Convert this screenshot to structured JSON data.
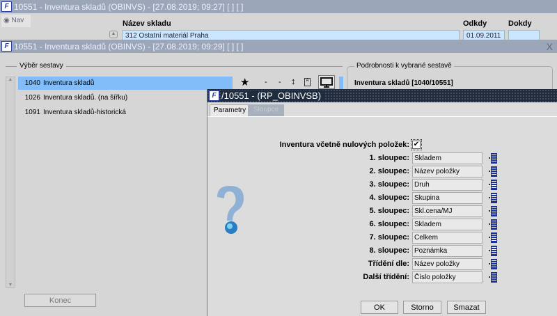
{
  "back_window": {
    "title": "10551 - Inventura skladů (OBINVS) - [27.08.2019; 09:27]  [ ]  [ ]",
    "nav_label": "Nav",
    "col_nazev": "Název skladu",
    "col_odkdy": "Odkdy",
    "col_dokdy": "Dokdy",
    "nazev_value": "312 Ostatní materiál Praha",
    "odkdy_value": "01.09.2011",
    "dokdy_value": ""
  },
  "front_window": {
    "title": "10551 - Inventura skladů (OBINVS) - [27.08.2019; 09:29]  [ ]  [ ]",
    "close": "X",
    "vyber_label": "Výběr sestavy",
    "detail_label": "Podrobnosti k vybrané sestavě",
    "detail_value": "Inventura skladů [1040/10551]",
    "reports": [
      {
        "num": "1040",
        "name": "Inventura skladů",
        "selected": true
      },
      {
        "num": "1026",
        "name": "Inventura skladů. (na šířku)"
      },
      {
        "num": "1091",
        "name": "Inventura skladů-historická"
      }
    ],
    "konec": "Konec",
    "toolbar": {
      "dash1": "-",
      "dash2": "-"
    }
  },
  "dialog": {
    "title": "/10551 - (RP_OBINVSB)",
    "tabs": [
      "Parametry",
      "Sloupce"
    ],
    "checkbox_label": "Inventura včetně nulových položek:",
    "checkbox_checked": true,
    "rows": [
      {
        "label": "1. sloupec:",
        "value": "Skladem"
      },
      {
        "label": "2. sloupec:",
        "value": "Název položky"
      },
      {
        "label": "3. sloupec:",
        "value": "Druh"
      },
      {
        "label": "4. sloupec:",
        "value": "Skupina"
      },
      {
        "label": "5. sloupec:",
        "value": "Skl.cena/MJ"
      },
      {
        "label": "6. sloupec:",
        "value": "Skladem"
      },
      {
        "label": "7. sloupec:",
        "value": "Celkem"
      },
      {
        "label": "8. sloupec:",
        "value": "Poznámka"
      },
      {
        "label": "Třídění dle:",
        "value": "Název položky"
      },
      {
        "label": "Další třídění:",
        "value": "Číslo položky"
      }
    ],
    "buttons": {
      "ok": "OK",
      "storno": "Storno",
      "smazat": "Smazat"
    }
  }
}
